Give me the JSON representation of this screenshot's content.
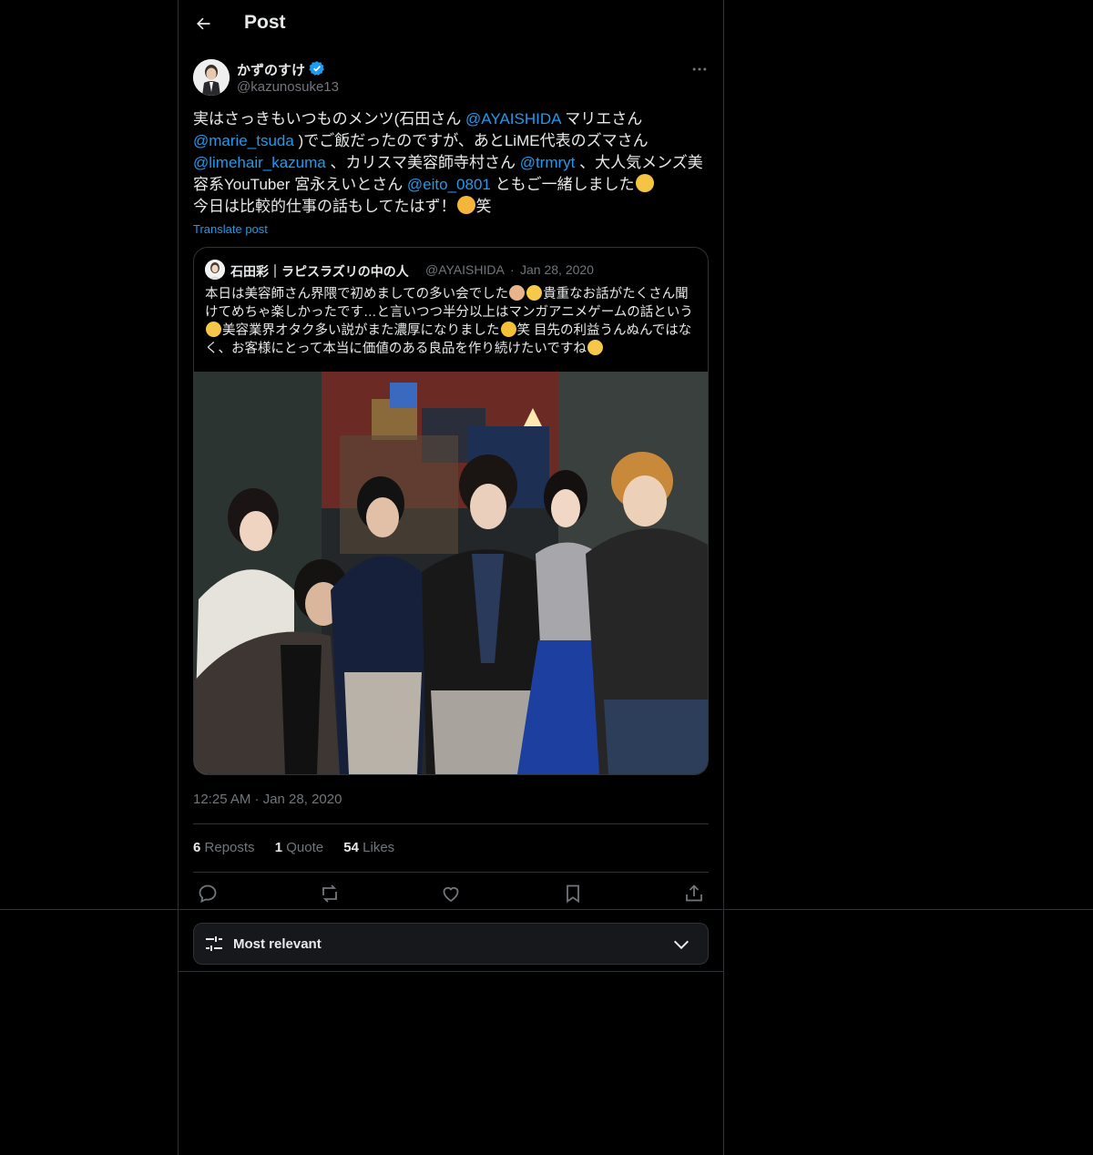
{
  "header": {
    "title": "Post"
  },
  "post": {
    "author_name": "かずのすけ",
    "handle": "@kazunosuke13",
    "text": {
      "p1": "実はさっきもいつものメンツ(石田さん ",
      "m1": "@AYAISHIDA",
      "p2": " マリエさん ",
      "m2": "@marie_tsuda",
      "p3": " )でご飯だったのですが、あとLiME代表のズマさん ",
      "m3": "@limehair_kazuma",
      "p4": " 、カリスマ美容師寺村さん ",
      "m4": "@trmryt",
      "p5": " 、大人気メンズ美容系YouTuber 宮永えいとさん ",
      "m5": "@eito_0801",
      "p6": " ともご一緒しました",
      "p7": "今日は比較的仕事の話もしてたはず！",
      "p8": "笑"
    },
    "translate_label": "Translate post",
    "quote": {
      "name": "石田彩｜ラピスラズリの中の人",
      "handle": "@AYAISHIDA",
      "separator": "·",
      "date": "Jan 28, 2020",
      "text_a": "本日は美容師さん界隈で初めましての多い会でした",
      "text_b": "貴重なお話がたくさん聞けてめちゃ楽しかったです…と言いつつ半分以上はマンガアニメゲームの話という",
      "text_c": "美容業界オタク多い説がまた濃厚になりました",
      "text_d": "笑 目先の利益うんぬんではなく、お客様にとって本当に価値のある良品を作り続けたいですね"
    },
    "timestamp": "12:25 AM · Jan 28, 2020",
    "stats": {
      "reposts_count": "6",
      "reposts_label": "Reposts",
      "quotes_count": "1",
      "quotes_label": "Quote",
      "likes_count": "54",
      "likes_label": "Likes"
    },
    "actions": [
      "reply-icon",
      "repost-icon",
      "like-icon",
      "bookmark-icon",
      "share-icon"
    ]
  },
  "sort": {
    "label": "Most relevant"
  },
  "colors": {
    "accent": "#1d9bf0",
    "muted": "#71767b",
    "text": "#e7e9ea",
    "border": "#2f3336"
  }
}
